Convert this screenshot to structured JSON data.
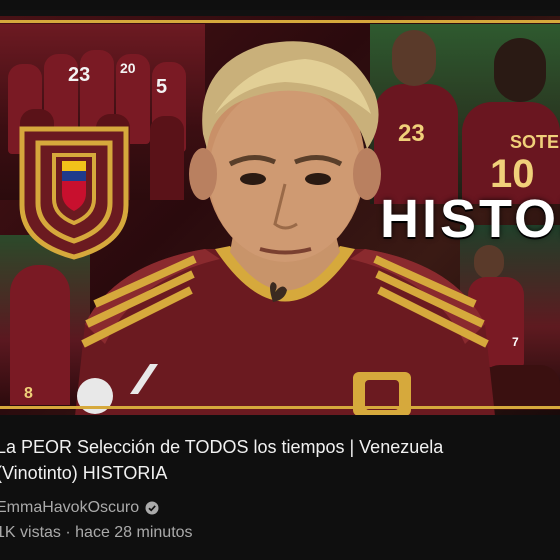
{
  "thumbnail": {
    "headline": "HISTORIA",
    "visible_fragments": {
      "sotelo_jersey": "SOTELDO",
      "player_numbers": [
        "23",
        "20",
        "5",
        "23",
        "10",
        "8",
        "7"
      ]
    }
  },
  "video": {
    "title": "La PEOR Selección de TODOS los tiempos | Venezuela\n(Vinotinto) HISTORIA",
    "channel": "EmmaHavokOscuro",
    "verified": true,
    "views": "1K vistas",
    "separator": " · ",
    "age": "hace 28 minutos"
  },
  "colors": {
    "background": "#0f0f0f",
    "title": "#f1f1f1",
    "secondary_text": "#aaaaaa",
    "accent_gold": "#d6a93c",
    "vinotinto": "#6d1a22"
  },
  "icons": {
    "verified": "verified-check-icon"
  }
}
